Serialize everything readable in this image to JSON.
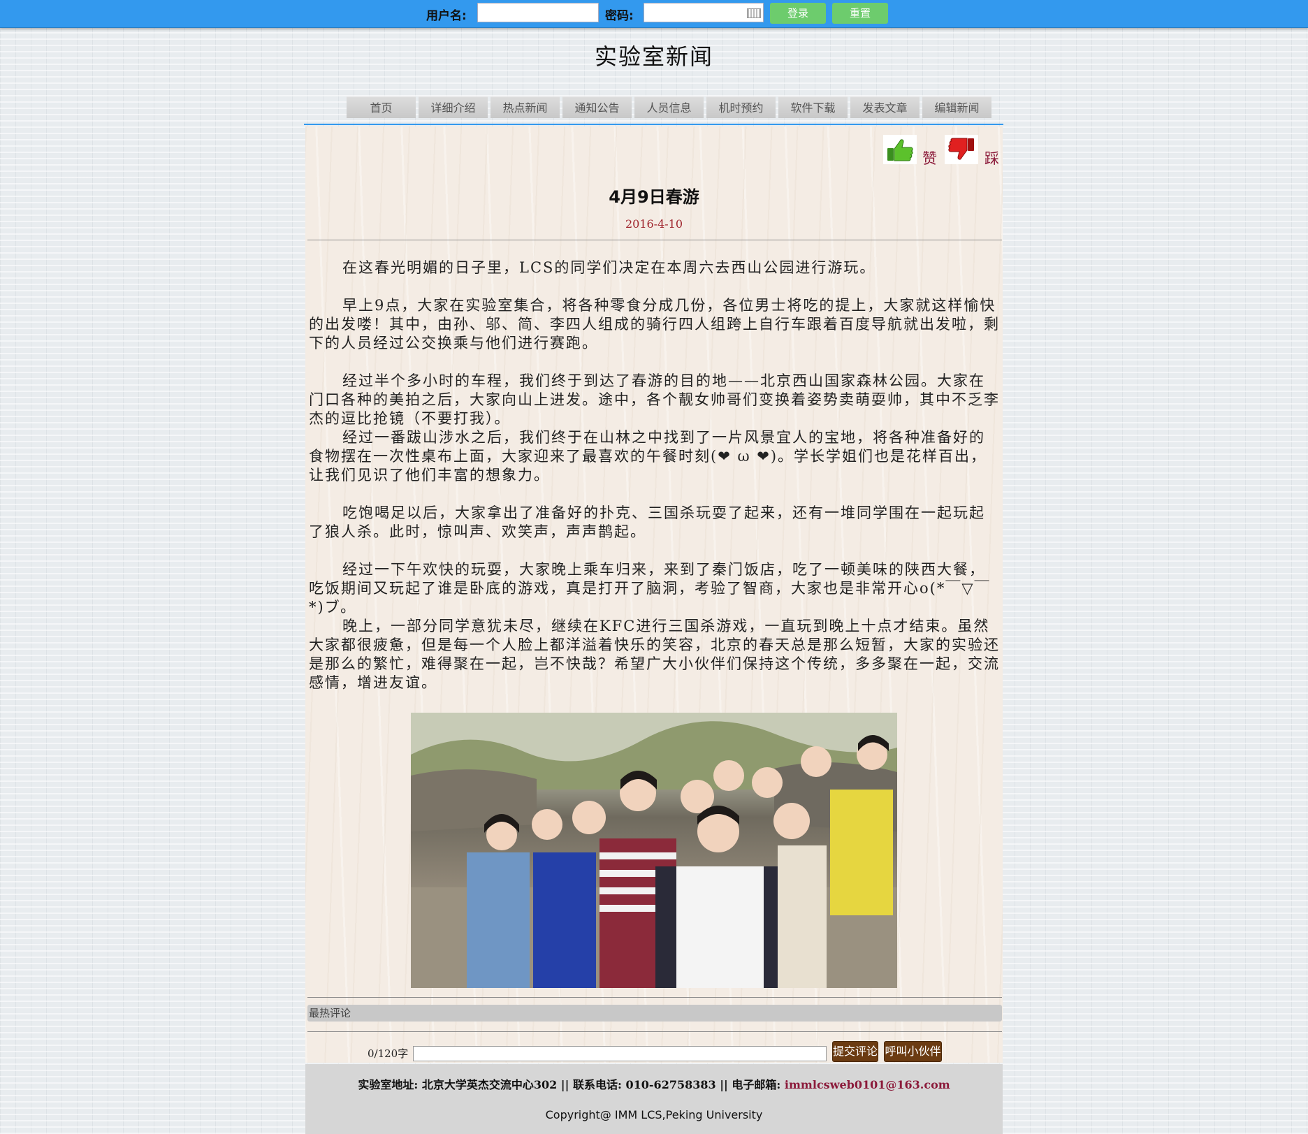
{
  "login": {
    "username_label": "用户名:",
    "username_value": "",
    "password_label": "密码:",
    "password_value": "",
    "login_button": "登录",
    "reset_button": "重置",
    "bar_color": "#3399ee",
    "button_color": "#6dcc6d"
  },
  "site_title": "实验室新闻",
  "nav": [
    "首页",
    "详细介绍",
    "热点新闻",
    "通知公告",
    "人员信息",
    "机时预约",
    "软件下载",
    "发表文章",
    "编辑新闻"
  ],
  "vote": {
    "like_label": "赞",
    "dislike_label": "踩",
    "like_icon": "thumbs-up-icon",
    "dislike_icon": "thumbs-down-icon"
  },
  "article": {
    "title": "4月9日春游",
    "date": "2016-4-10",
    "paragraphs": [
      "在这春光明媚的日子里，LCS的同学们决定在本周六去西山公园进行游玩。",
      "早上9点，大家在实验室集合，将各种零食分成几份，各位男士将吃的提上，大家就这样愉快的出发喽！其中，由孙、邬、简、李四人组成的骑行四人组跨上自行车跟着百度导航就出发啦，剩下的人员经过公交换乘与他们进行赛跑。",
      "经过半个多小时的车程，我们终于到达了春游的目的地——北京西山国家森林公园。大家在门口各种的美拍之后，大家向山上进发。途中，各个靓女帅哥们变换着姿势卖萌耍帅，其中不乏李杰的逗比抢镜（不要打我）。",
      "经过一番跋山涉水之后，我们终于在山林之中找到了一片风景宜人的宝地，将各种准备好的食物摆在一次性桌布上面，大家迎来了最喜欢的午餐时刻(❤ ω ❤)。学长学姐们也是花样百出，让我们见识了他们丰富的想象力。",
      "吃饱喝足以后，大家拿出了准备好的扑克、三国杀玩耍了起来，还有一堆同学围在一起玩起了狼人杀。此时，惊叫声、欢笑声，声声鹊起。",
      "经过一下午欢快的玩耍，大家晚上乘车归来，来到了秦门饭店，吃了一顿美味的陕西大餐，吃饭期间又玩起了谁是卧底的游戏，真是打开了脑洞，考验了智商，大家也是非常开心o(*￣▽￣*)ブ。",
      "晚上，一部分同学意犹未尽，继续在KFC进行三国杀游戏，一直玩到晚上十点才结束。虽然大家都很疲惫，但是每一个人脸上都洋溢着快乐的笑容，北京的春天总是那么短暂，大家的实验还是那么的繁忙，难得聚在一起，岂不快哉？希望广大小伙伴们保持这个传统，多多聚在一起，交流感情，增进友谊。"
    ]
  },
  "comments": {
    "heading": "最热评论",
    "counter": "0/120字",
    "input_value": "",
    "submit_button": "提交评论",
    "call_button": "呼叫小伙伴"
  },
  "footer": {
    "address_label": "实验室地址:",
    "address": "北京大学英杰交流中心302",
    "sep": "||",
    "phone_label": "联系电话:",
    "phone": "010-62758383",
    "email_label": "电子邮箱:",
    "email": "immlcsweb0101@163.com",
    "copyright": "Copyright@ IMM LCS,Peking University"
  }
}
